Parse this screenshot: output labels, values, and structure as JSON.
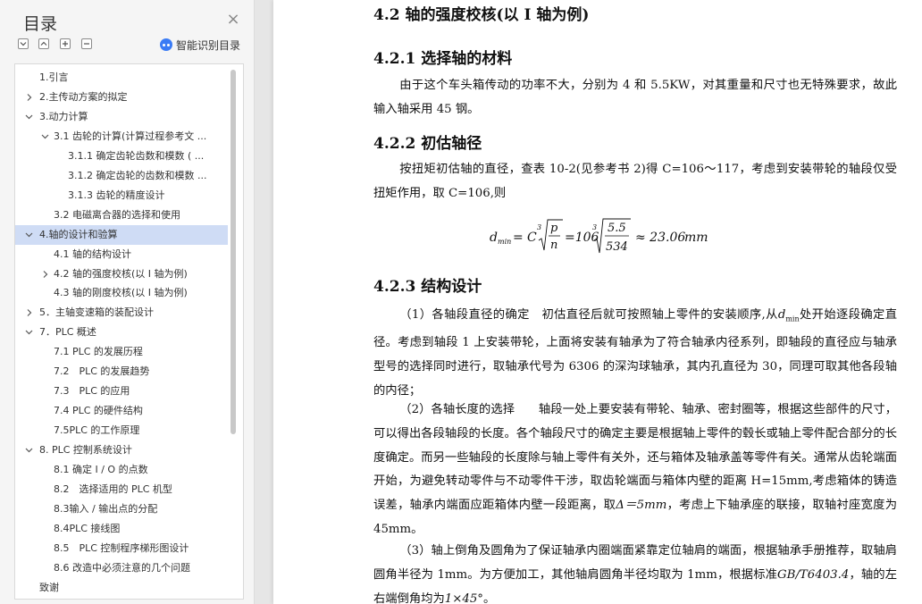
{
  "sidebar": {
    "title": "目录",
    "smart_label": "智能识别目录",
    "items": [
      {
        "label": "1.引言",
        "level": 0,
        "chevron": ""
      },
      {
        "label": "2.主传动方案的拟定",
        "level": 0,
        "chevron": "right"
      },
      {
        "label": "3.动力计算",
        "level": 0,
        "chevron": "down"
      },
      {
        "label": "3.1 齿轮的计算(计算过程参考文 ...",
        "level": 1,
        "chevron": "down"
      },
      {
        "label": "3.1.1 确定齿轮齿数和模数 ( ...",
        "level": 2,
        "chevron": ""
      },
      {
        "label": "3.1.2 确定齿轮的齿数和模数 ...",
        "level": 2,
        "chevron": ""
      },
      {
        "label": "3.1.3 齿轮的精度设计",
        "level": 2,
        "chevron": ""
      },
      {
        "label": "3.2 电磁离合器的选择和使用",
        "level": 1,
        "chevron": ""
      },
      {
        "label": "4.轴的设计和验算",
        "level": 0,
        "chevron": "down",
        "selected": true
      },
      {
        "label": "4.1 轴的结构设计",
        "level": 1,
        "chevron": ""
      },
      {
        "label": "4.2 轴的强度校核(以 I 轴为例)",
        "level": 1,
        "chevron": "right"
      },
      {
        "label": "4.3 轴的刚度校核(以 I 轴为例)",
        "level": 1,
        "chevron": ""
      },
      {
        "label": "5．主轴变速箱的装配设计",
        "level": 0,
        "chevron": "right"
      },
      {
        "label": "7．PLC 概述",
        "level": 0,
        "chevron": "down"
      },
      {
        "label": "7.1 PLC 的发展历程",
        "level": 1,
        "chevron": ""
      },
      {
        "label": "7.2　PLC 的发展趋势",
        "level": 1,
        "chevron": ""
      },
      {
        "label": "7.3　PLC 的应用",
        "level": 1,
        "chevron": ""
      },
      {
        "label": "7.4 PLC 的硬件结构",
        "level": 1,
        "chevron": ""
      },
      {
        "label": "7.5PLC 的工作原理",
        "level": 1,
        "chevron": ""
      },
      {
        "label": "8. PLC 控制系统设计",
        "level": 0,
        "chevron": "down"
      },
      {
        "label": "8.1 确定 I / O 的点数",
        "level": 1,
        "chevron": ""
      },
      {
        "label": "8.2　选择适用的 PLC 机型",
        "level": 1,
        "chevron": ""
      },
      {
        "label": "8.3输入 / 输出点的分配",
        "level": 1,
        "chevron": ""
      },
      {
        "label": "8.4PLC 接线图",
        "level": 1,
        "chevron": ""
      },
      {
        "label": "8.5　PLC 控制程序梯形图设计",
        "level": 1,
        "chevron": ""
      },
      {
        "label": "8.6 改造中必须注意的几个问题",
        "level": 1,
        "chevron": ""
      },
      {
        "label": "致谢",
        "level": -1,
        "chevron": ""
      }
    ]
  },
  "document": {
    "h_42": "4.2 轴的强度校核(以 I 轴为例)",
    "h_421": "4.2.1 选择轴的材料",
    "p_421": "由于这个车头箱传动的功率不大，分别为 4 和 5.5KW，对其重量和尺寸也无特殊要求，故此输入轴采用 45 钢。",
    "h_422": "4.2.2 初估轴径",
    "p_422": "按扭矩初估轴的直径，查表 10-2(见参考书 2)得 C=106～117，考虑到安装带轮的轴段仅受扭矩作用，取 C=106,则",
    "formula": {
      "lhs": "d",
      "lhs_sub": "min",
      "eq1": "=",
      "c": "C",
      "root_index": "3",
      "num1": "p",
      "den1": "n",
      "eq2": "=106",
      "num2": "5.5",
      "den2": "534",
      "approx": "≈ 23.06",
      "unit": "mm"
    },
    "h_423": "4.2.3 结构设计",
    "p1_a": "（1）各轴段直径的确定　初估直径后就可按照轴上零件的安装顺序,从",
    "p1_d": "d",
    "p1_sub": "min",
    "p1_b": "处开始逐段确定直径。考虑到轴段 1 上安装带轮，上面将安装有轴承为了符合轴承内径系列，即轴段的直径应与轴承型号的选择同时进行，取轴承代号为 6306 的深沟球轴承，其内孔直径为 30，同理可取其他各段轴的内径；",
    "p2_a": "（2）各轴长度的选择　　轴段一处上要安装有带轮、轴承、密封圈等，根据这些部件的尺寸，可以得出各段轴段的长度。各个轴段尺寸的确定主要是根据轴上零件的毂长或轴上零件配合部分的长度确定。而另一些轴段的长度除与轴上零件有关外，还与箱体及轴承盖等零件有关。通常从齿轮端面开始，为避免转动零件与不动零件干涉，取齿轮端面与箱体内壁的距离 H=15mm,考虑箱体的铸造误差，轴承内端面应距箱体内壁一段距离，取",
    "p2_delta": "Δ＝5mm",
    "p2_b": "，考虑上下轴承座的联接，取轴衬座宽度为 45mm。",
    "p3_a": "（3）轴上倒角及圆角为了保证轴承内圈端面紧靠定位轴肩的端面，根据轴承手册推荐，取轴肩圆角半径为 1mm。为方便加工，其他轴肩圆角半径均取为 1mm，根据标准",
    "p3_gb": "GB/T6403.4",
    "p3_b": "，轴的左右端倒角均为",
    "p3_c": "1×45°",
    "p3_d": "。"
  }
}
